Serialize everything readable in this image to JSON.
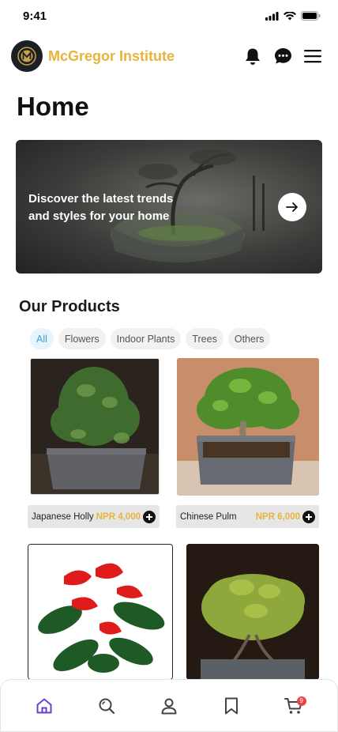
{
  "status_bar": {
    "time": "9:41"
  },
  "header": {
    "brand": "McGregor Institute"
  },
  "page": {
    "title": "Home"
  },
  "hero": {
    "text": "Discover the latest trends and styles for your home"
  },
  "products_section": {
    "title": "Our Products",
    "categories": [
      "All",
      "Flowers",
      "Indoor Plants",
      "Trees",
      "Others"
    ],
    "active_category": "All",
    "items": [
      {
        "name": "Japanese Holly",
        "price": "NPR 4,000"
      },
      {
        "name": "Chinese Pulm",
        "price": "NPR 6,000"
      }
    ]
  },
  "bottom_nav": {
    "items": [
      "home-icon",
      "search-icon",
      "profile-icon",
      "bookmark-icon",
      "cart-icon"
    ],
    "active": "home-icon",
    "cart_count": "9"
  },
  "colors": {
    "brand": "#e9b23b",
    "accent": "#6a3fd1",
    "chip_active": "#3aa0d8",
    "badge": "#e84545"
  }
}
